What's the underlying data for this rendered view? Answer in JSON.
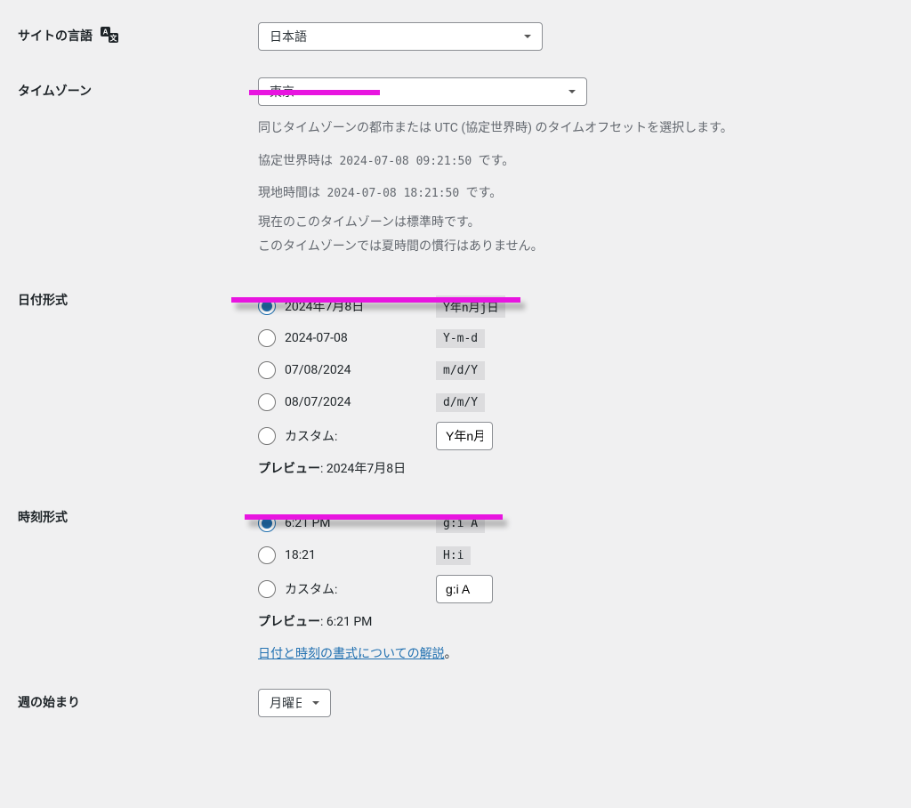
{
  "language": {
    "label": "サイトの言語",
    "value": "日本語"
  },
  "timezone": {
    "label": "タイムゾーン",
    "value": "東京",
    "help": "同じタイムゾーンの都市または UTC (協定世界時) のタイムオフセットを選択します。",
    "utc_prefix": "協定世界時は ",
    "utc_time": "2024-07-08 09:21:50",
    "utc_suffix": " です。",
    "local_prefix": "現地時間は ",
    "local_time": "2024-07-08 18:21:50",
    "local_suffix": " です。",
    "std_line": "現在のこのタイムゾーンは標準時です。",
    "dst_line": "このタイムゾーンでは夏時間の慣行はありません。"
  },
  "date_format": {
    "label": "日付形式",
    "options": [
      {
        "display": "2024年7月8日",
        "code": "Y年n月j日",
        "checked": true
      },
      {
        "display": "2024-07-08",
        "code": "Y-m-d",
        "checked": false
      },
      {
        "display": "07/08/2024",
        "code": "m/d/Y",
        "checked": false
      },
      {
        "display": "08/07/2024",
        "code": "d/m/Y",
        "checked": false
      }
    ],
    "custom_label": "カスタム:",
    "custom_value": "Y年n月",
    "preview_label": "プレビュー",
    "preview_value": "2024年7月8日"
  },
  "time_format": {
    "label": "時刻形式",
    "options": [
      {
        "display": "6:21 PM",
        "code": "g:i A",
        "checked": true
      },
      {
        "display": "18:21",
        "code": "H:i",
        "checked": false
      }
    ],
    "custom_label": "カスタム:",
    "custom_value": "g:i A",
    "preview_label": "プレビュー",
    "preview_value": "6:21 PM",
    "doc_link": "日付と時刻の書式についての解説",
    "doc_suffix": "。"
  },
  "week_start": {
    "label": "週の始まり",
    "value": "月曜日"
  }
}
